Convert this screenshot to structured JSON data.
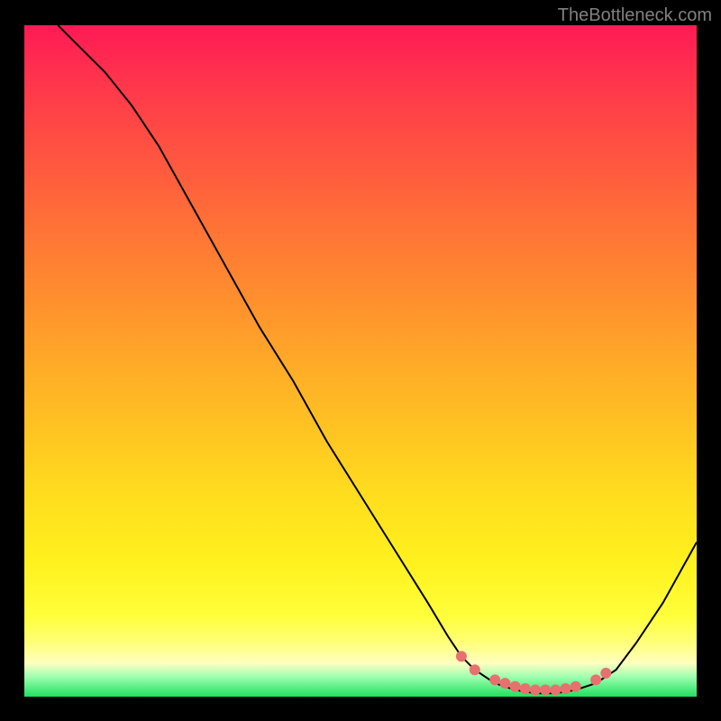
{
  "watermark": "TheBottleneck.com",
  "chart_data": {
    "type": "line",
    "title": "",
    "xlabel": "",
    "ylabel": "",
    "x_range": [
      0,
      100
    ],
    "y_range": [
      0,
      100
    ],
    "curve_points": [
      {
        "x": 5,
        "y": 100
      },
      {
        "x": 8,
        "y": 97
      },
      {
        "x": 12,
        "y": 93
      },
      {
        "x": 16,
        "y": 88
      },
      {
        "x": 20,
        "y": 82
      },
      {
        "x": 25,
        "y": 73
      },
      {
        "x": 30,
        "y": 64
      },
      {
        "x": 35,
        "y": 55
      },
      {
        "x": 40,
        "y": 47
      },
      {
        "x": 45,
        "y": 38
      },
      {
        "x": 50,
        "y": 30
      },
      {
        "x": 55,
        "y": 22
      },
      {
        "x": 60,
        "y": 14
      },
      {
        "x": 63,
        "y": 9
      },
      {
        "x": 65,
        "y": 6
      },
      {
        "x": 67,
        "y": 4
      },
      {
        "x": 70,
        "y": 2
      },
      {
        "x": 73,
        "y": 1
      },
      {
        "x": 76,
        "y": 0.5
      },
      {
        "x": 79,
        "y": 0.5
      },
      {
        "x": 82,
        "y": 1
      },
      {
        "x": 85,
        "y": 2
      },
      {
        "x": 88,
        "y": 4
      },
      {
        "x": 91,
        "y": 8
      },
      {
        "x": 95,
        "y": 14
      },
      {
        "x": 100,
        "y": 23
      }
    ],
    "dots": [
      {
        "x": 65,
        "y": 6
      },
      {
        "x": 67,
        "y": 4
      },
      {
        "x": 70,
        "y": 2.5
      },
      {
        "x": 71.5,
        "y": 2
      },
      {
        "x": 73,
        "y": 1.5
      },
      {
        "x": 74.5,
        "y": 1.2
      },
      {
        "x": 76,
        "y": 1
      },
      {
        "x": 77.5,
        "y": 1
      },
      {
        "x": 79,
        "y": 1
      },
      {
        "x": 80.5,
        "y": 1.2
      },
      {
        "x": 82,
        "y": 1.5
      },
      {
        "x": 85,
        "y": 2.5
      },
      {
        "x": 86.5,
        "y": 3.5
      }
    ],
    "gradient_stops": [
      {
        "offset": 0,
        "color": "#ff1a55"
      },
      {
        "offset": 50,
        "color": "#ffa928"
      },
      {
        "offset": 88,
        "color": "#ffff3a"
      },
      {
        "offset": 100,
        "color": "#20e060"
      }
    ]
  }
}
